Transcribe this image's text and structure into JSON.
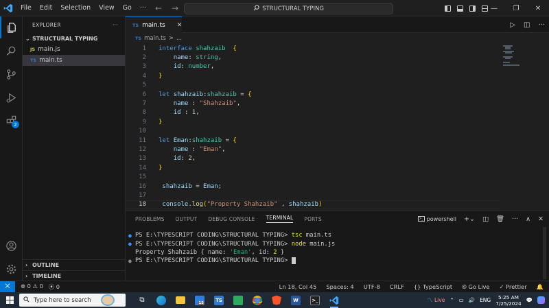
{
  "window": {
    "menu": [
      "File",
      "Edit",
      "Selection",
      "View",
      "Go",
      "···"
    ],
    "search": "STRUCTURAL TYPING"
  },
  "activity_bar": {
    "extensions_badge": "2"
  },
  "explorer": {
    "header": "EXPLORER",
    "more": "···",
    "folder": "STRUCTURAL TYPING",
    "files": [
      {
        "icon": "JS",
        "name": "main.js"
      },
      {
        "icon": "TS",
        "name": "main.ts"
      }
    ],
    "outline": "OUTLINE",
    "timeline": "TIMELINE"
  },
  "editor": {
    "tab": {
      "icon": "TS",
      "name": "main.ts",
      "close": "✕"
    },
    "breadcrumb": {
      "icon": "TS",
      "file": "main.ts",
      "sep": ">",
      "rest": "..."
    },
    "line_numbers": [
      "1",
      "2",
      "3",
      "4",
      "5",
      "6",
      "7",
      "8",
      "9",
      "10",
      "11",
      "12",
      "13",
      "14",
      "15",
      "16",
      "17",
      "18"
    ],
    "current_line": "18"
  },
  "panel": {
    "tabs": [
      "PROBLEMS",
      "OUTPUT",
      "DEBUG CONSOLE",
      "TERMINAL",
      "PORTS"
    ],
    "active_tab": "TERMINAL",
    "shell": "powershell",
    "terminal": {
      "line1_prompt": "PS E:\\TYPESCRIPT CODING\\STRUCTURAL TYPING> ",
      "line1_cmd": "tsc",
      "line1_arg": " main.ts",
      "line2_prompt": "PS E:\\TYPESCRIPT CODING\\STRUCTURAL TYPING> ",
      "line2_cmd": "node",
      "line2_arg": " main.js",
      "output_a": "Property Shahzaib { name: ",
      "output_b": "'Eman'",
      "output_c": ", id: ",
      "output_d": "2",
      "output_e": " }",
      "line4_prompt": "PS E:\\TYPESCRIPT CODING\\STRUCTURAL TYPING> "
    }
  },
  "status_bar": {
    "errors": "⊗ 0 ⚠ 0",
    "ports": "⦿ 0",
    "position": "Ln 18, Col 45",
    "spaces": "Spaces: 4",
    "encoding": "UTF-8",
    "eol": "CRLF",
    "language": "{} TypeScript",
    "golive": "Go Live",
    "prettier": "✓ Prettier"
  },
  "taskbar": {
    "search_placeholder": "Type here to search",
    "mail_badge": "15",
    "weather": "Live",
    "time": "5:25 AM",
    "date": "7/25/2024"
  }
}
